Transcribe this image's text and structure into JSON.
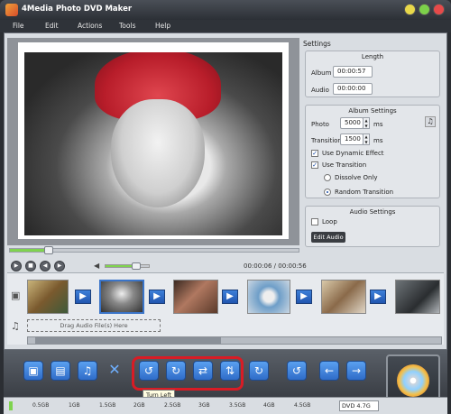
{
  "app": {
    "title": "4Media Photo DVD Maker"
  },
  "menu": [
    "File",
    "Edit",
    "Actions",
    "Tools",
    "Help"
  ],
  "preview": {
    "progress_fraction": 0.13,
    "volume_fraction": 0.7,
    "time_current": "00:00:06",
    "time_total": "00:00:56",
    "time_separator": " / "
  },
  "settings": {
    "title": "Settings",
    "length": {
      "title": "Length",
      "album_label": "Album",
      "album_value": "00:00:57",
      "audio_label": "Audio",
      "audio_value": "00:00:00"
    },
    "album_settings": {
      "title": "Album Settings",
      "photo_label": "Photo",
      "photo_value": "5000",
      "photo_unit": "ms",
      "transition_label": "Transition",
      "transition_value": "1500",
      "transition_unit": "ms",
      "use_dynamic_effect": "Use Dynamic Effect",
      "use_transition": "Use Transition",
      "dissolve_only": "Dissolve Only",
      "random_transition": "Random Transition"
    },
    "audio_settings": {
      "title": "Audio Settings",
      "loop_label": "Loop",
      "edit_audio": "Edit Audio"
    }
  },
  "timeline": {
    "drag_audio": "Drag Audio File(s) Here"
  },
  "toolbar": {
    "tooltip": "Turn Left"
  },
  "capacity": {
    "ticks": [
      "0.5GB",
      "1GB",
      "1.5GB",
      "2GB",
      "2.5GB",
      "3GB",
      "3.5GB",
      "4GB",
      "4.5GB"
    ],
    "disc": "DVD 4.7G",
    "used_fraction": 0.01
  },
  "colors": {
    "accent_blue": "#2f6cc8",
    "highlight_red": "#d81c25",
    "progress_green": "#7fd34f"
  },
  "icons": {
    "add_photo": "add-photo-icon",
    "add_folder": "add-folder-icon",
    "add_music": "add-music-icon",
    "delete": "delete-icon",
    "turn_left": "rotate-left-icon",
    "turn_right": "rotate-right-icon",
    "flip_horizontal": "flip-horizontal-icon",
    "flip_vertical": "flip-vertical-icon",
    "redo": "redo-icon",
    "undo": "undo-icon",
    "move_left": "move-left-icon",
    "move_right": "move-right-icon"
  }
}
